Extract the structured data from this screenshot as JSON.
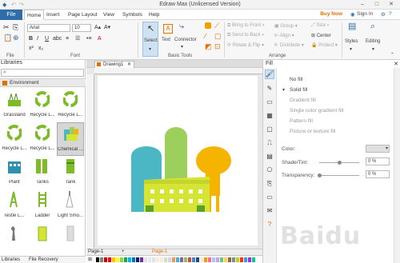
{
  "window": {
    "title": "Edraw Max (Unlicensed Version)"
  },
  "menu": {
    "file": "File",
    "items": [
      "Home",
      "Insert",
      "Page Layout",
      "View",
      "Symbols",
      "Help"
    ],
    "buy_now": "Buy Now",
    "sign_in": "Sign In"
  },
  "ribbon": {
    "groups": {
      "file": "File",
      "font": "Font",
      "basic_tools": "Basic Tools",
      "arrange": "Arrange"
    },
    "font_name": "Arial",
    "font_size": "10",
    "tools": {
      "select": "Select",
      "text": "Text",
      "connector": "Connector"
    },
    "arrange": {
      "bring_to_front": "Bring to Front",
      "send_to_back": "Send to Back",
      "rotate_flip": "Rotate & Flip",
      "group": "Group",
      "align": "Align",
      "distribute": "Distribute",
      "size": "Size",
      "center": "Center",
      "protect": "Protect"
    },
    "styles": "Styles",
    "editing": "Editing"
  },
  "libraries": {
    "title": "Libraries",
    "category": "Environment",
    "shapes": [
      {
        "label": "Grassland"
      },
      {
        "label": "Recycle L..."
      },
      {
        "label": "Recycle L..."
      },
      {
        "label": "Recycle L..."
      },
      {
        "label": "Recycle L..."
      },
      {
        "label": "Chemical ..."
      },
      {
        "label": "Plant"
      },
      {
        "label": "Tanks"
      },
      {
        "label": "Tank"
      },
      {
        "label": "restle L..."
      },
      {
        "label": "Ladder"
      },
      {
        "label": "Light Smo..."
      },
      {
        "label": ""
      },
      {
        "label": ""
      },
      {
        "label": ""
      }
    ],
    "footer_tabs": [
      "Libraries",
      "File Recovery"
    ]
  },
  "document": {
    "tab": "Drawing1",
    "page_tabs": [
      "Page-1",
      "Page-1"
    ]
  },
  "fill_panel": {
    "title": "Fill",
    "options": [
      "No fill",
      "Solid fill",
      "Gradient fill",
      "Single color gradient fill",
      "Pattern fill",
      "Picture or texture fill"
    ],
    "selected": "Solid fill",
    "color_label": "Color:",
    "shade_label": "Shade/Tint:",
    "shade_value": "0 %",
    "transparency_label": "Transparency:",
    "transparency_value": "0 %"
  },
  "colors": {
    "accent_blue": "#2f6da8",
    "buy_now": "#e07000",
    "palette": [
      "#000000",
      "#7f7f7f",
      "#c00000",
      "#ff0000",
      "#ffc000",
      "#ffff00",
      "#92d050",
      "#00b050",
      "#00b0f0",
      "#0070c0",
      "#002060",
      "#7030a0",
      "#f2dcdb",
      "#dbeef3",
      "#e5e0ec",
      "#fde9d9",
      "#ebf1dd",
      "#ddd9c3",
      "#c6d9f0",
      "#f79646",
      "#4bacc6",
      "#8064a2",
      "#9bbb59",
      "#c0504d",
      "#4f81bd",
      "#1f497d",
      "#eeece1",
      "#ff9900",
      "#ff6699",
      "#99ccff",
      "#cc99ff",
      "#66cc66",
      "#ffcc66",
      "#996633",
      "#669999",
      "#cccc00",
      "#ff3300",
      "#3399ff",
      "#9933cc",
      "#00cc99"
    ]
  },
  "watermark": "Baidu"
}
